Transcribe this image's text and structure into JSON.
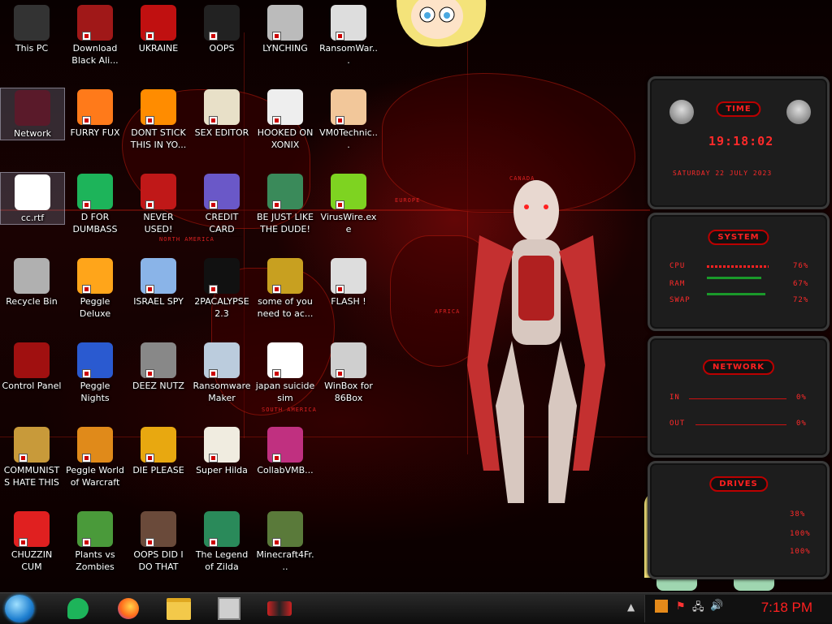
{
  "desktop": {
    "icons": [
      {
        "label": "This PC",
        "icon": "monitor-icon"
      },
      {
        "label": "Download Black Ali...",
        "icon": "alien-download-icon"
      },
      {
        "label": "UKRAINE",
        "icon": "radiation-icon"
      },
      {
        "label": "OOPS",
        "icon": "tablet-icon"
      },
      {
        "label": "LYNCHING",
        "icon": "figure-icon"
      },
      {
        "label": "RansomWar...",
        "icon": "skull-icon"
      },
      {
        "label": "Network",
        "icon": "network-icon"
      },
      {
        "label": "FURRY FUX",
        "icon": "firefox-icon"
      },
      {
        "label": "DONT STICK THIS IN YO...",
        "icon": "vlc-cone-icon"
      },
      {
        "label": "SEX EDITOR",
        "icon": "hxd-icon"
      },
      {
        "label": "HOOKED ON XONIX",
        "icon": "xonix-icon"
      },
      {
        "label": "VM0Technic...",
        "icon": "doctor-icon"
      },
      {
        "label": "cc.rtf",
        "icon": "rtf-document-icon"
      },
      {
        "label": "D FOR DUMBASS",
        "icon": "d-app-icon"
      },
      {
        "label": "NEVER USED!",
        "icon": "devcpp-icon"
      },
      {
        "label": "CREDIT CARD CHECKER",
        "icon": "credit-card-icon"
      },
      {
        "label": "BE JUST LIKE THE DUDE!",
        "icon": "santa-icon"
      },
      {
        "label": "VirusWire.exe",
        "icon": "lime-icon"
      },
      {
        "label": "Recycle Bin",
        "icon": "recycle-bin-icon"
      },
      {
        "label": "Peggle Deluxe",
        "icon": "peggle-icon"
      },
      {
        "label": "ISRAEL SPY",
        "icon": "spy-network-icon"
      },
      {
        "label": "2PACALYPSE 2.3",
        "icon": "terminal-icon"
      },
      {
        "label": "some of you need to ac...",
        "icon": "beaver-icon"
      },
      {
        "label": "FLASH !",
        "icon": "flash-file-icon"
      },
      {
        "label": "Control Panel",
        "icon": "control-panel-icon"
      },
      {
        "label": "Peggle Nights Deluxe",
        "icon": "peggle-nights-icon"
      },
      {
        "label": "DEEZ NUTZ",
        "icon": "windows-stack-icon"
      },
      {
        "label": "Ransomware Maker Build...",
        "icon": "builder-icon"
      },
      {
        "label": "japan suicide sim",
        "icon": "figures-icon"
      },
      {
        "label": "WinBox for 86Box",
        "icon": "winbox-icon"
      },
      {
        "label": "COMMUNISTS HATE THIS G...",
        "icon": "money-bag-icon"
      },
      {
        "label": "Peggle World of Warcraft ...",
        "icon": "peggle-wow-icon"
      },
      {
        "label": "DIE PLEASE",
        "icon": "de-icon"
      },
      {
        "label": "Super Hilda",
        "icon": "pixel-dog-icon"
      },
      {
        "label": "CollabVMB...",
        "icon": "collabvm-icon"
      },
      {
        "label": "CHUZZIN CUM",
        "icon": "chuzzle-icon"
      },
      {
        "label": "Plants vs Zombies",
        "icon": "pvz-icon"
      },
      {
        "label": "OOPS DID I DO THAT",
        "icon": "portrait-icon"
      },
      {
        "label": "The Legend of Zilda",
        "icon": "zelda-icon"
      },
      {
        "label": "Minecraft4Fr...",
        "icon": "minecraft-block-icon"
      }
    ],
    "map_labels": {
      "north_america": "NORTH AMERICA",
      "south_america": "SOUTH AMERICA",
      "europe": "EUROPE",
      "africa": "AFRICA",
      "canada": "CANADA"
    }
  },
  "gadget": {
    "time_title": "TIME",
    "time": "19:18:02",
    "date": "SATURDAY 22 JULY 2023",
    "system_title": "SYSTEM",
    "cpu_label": "CPU",
    "cpu_value": "76%",
    "cpu_level": 0.76,
    "ram_label": "RAM",
    "ram_value": "67%",
    "ram_level": 0.67,
    "swap_label": "SWAP",
    "swap_value": "72%",
    "swap_level": 0.72,
    "network_title": "NETWORK",
    "in_label": "IN",
    "in_value": "0%",
    "out_label": "OUT",
    "out_value": "0%",
    "drives_title": "DRIVES",
    "drive1_value": "38%",
    "drive2_value": "100%",
    "drive3_value": "100%"
  },
  "taskbar": {
    "start_icon": "start-orb-icon",
    "apps": [
      {
        "icon": "d-app-icon"
      },
      {
        "icon": "firefox-icon"
      },
      {
        "icon": "file-explorer-icon"
      },
      {
        "icon": "winbox-icon"
      },
      {
        "icon": "control-panel-icon"
      }
    ],
    "tray_icons": [
      "up-arrow-icon",
      "app-tray-icon",
      "flag-icon",
      "network-tray-icon",
      "volume-icon"
    ],
    "clock": "7:18 PM"
  },
  "colors": {
    "accent": "#ff2020",
    "background": "#0a0000",
    "taskbar": "#1a1a1a"
  }
}
